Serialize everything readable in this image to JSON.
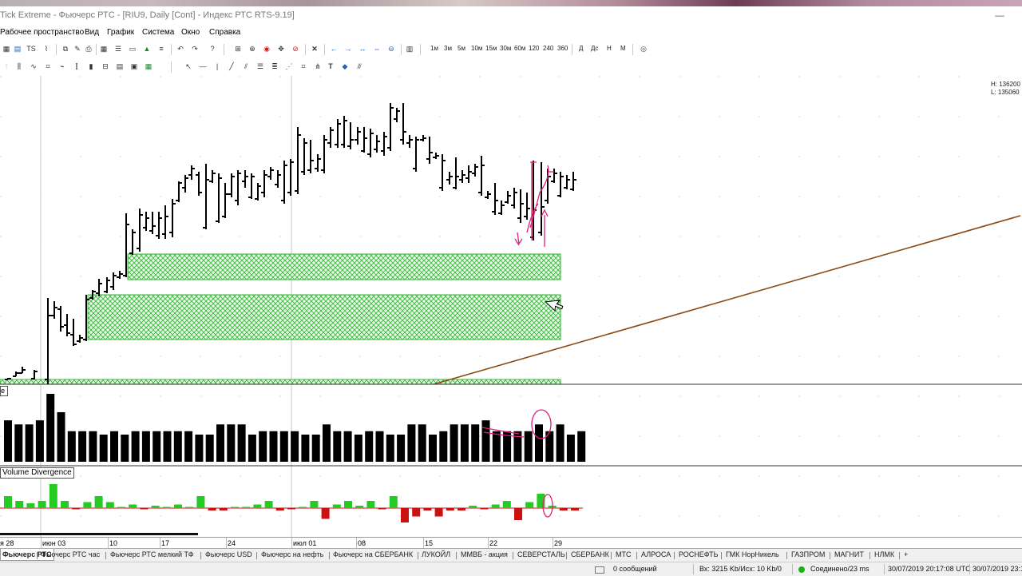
{
  "window": {
    "title": "Tick Extreme - Фьючерс РТС - [RIU9, Daily [Cont] - Индекс РТС RTS-9.19]"
  },
  "menu": [
    "Рабочее пространство",
    "Вид",
    "График",
    "Система",
    "Окно",
    "Справка"
  ],
  "toolbar": {
    "timeframes": [
      "1м",
      "3м",
      "5м",
      "10м",
      "15м",
      "30м",
      "60м",
      "120",
      "240",
      "360"
    ],
    "periods": [
      "Д",
      "Дс",
      "Н",
      "М"
    ]
  },
  "chart": {
    "hl": {
      "high": "H: 136200",
      "low": "L: 135060"
    },
    "indicator_label": "Volume Divergence",
    "price_label_stub": "e",
    "zones_color": "#2db82d",
    "trendline_color": "#8b4a12",
    "annotation_color": "#e0207a",
    "divergence_up_color": "#22cc22",
    "divergence_down_color": "#cc1111"
  },
  "date_axis": {
    "labels": [
      "я 28",
      "июн 03",
      "10",
      "17",
      "24",
      "июл 01",
      "08",
      "15",
      "22",
      "29"
    ]
  },
  "chart_data": {
    "type": "bar",
    "categories": [
      "я 28",
      "июн 03",
      "10",
      "17",
      "24",
      "июл 01",
      "08",
      "15",
      "22",
      "29"
    ],
    "volume_relative": [
      0.61,
      0.55,
      0.55,
      0.61,
      1.0,
      0.73,
      0.45,
      0.45,
      0.45,
      0.4,
      0.45,
      0.4,
      0.45,
      0.45,
      0.45,
      0.45,
      0.45,
      0.45,
      0.4,
      0.4,
      0.55,
      0.55,
      0.55,
      0.4,
      0.45,
      0.45,
      0.45,
      0.45,
      0.4,
      0.4,
      0.55,
      0.45,
      0.45,
      0.4,
      0.45,
      0.45,
      0.4,
      0.4,
      0.55,
      0.55,
      0.4,
      0.45,
      0.55,
      0.55,
      0.55,
      0.61,
      0.45,
      0.45,
      0.45,
      0.45,
      0.55,
      0.45,
      0.55,
      0.4,
      0.45
    ],
    "volume_divergence_relative": [
      0.5,
      0.3,
      0.2,
      0.3,
      1.0,
      0.3,
      -0.05,
      0.25,
      0.5,
      0.25,
      0.05,
      0.15,
      -0.05,
      0.1,
      0.05,
      0.15,
      0.05,
      0.5,
      -0.1,
      -0.1,
      0.05,
      0.05,
      0.15,
      0.3,
      -0.1,
      -0.05,
      0.05,
      0.3,
      -0.45,
      0.15,
      0.3,
      0.1,
      0.3,
      -0.05,
      0.5,
      -0.6,
      -0.35,
      -0.1,
      -0.35,
      -0.1,
      -0.1,
      0.1,
      -0.05,
      0.15,
      0.3,
      -0.5,
      0.25,
      0.6,
      0.1,
      -0.1,
      -0.1
    ]
  },
  "sheet_tabs": [
    "Фьючерс РТС",
    "Фьючерс РТС час",
    "Фьючерс РТС мелкий ТФ",
    "Фьючерс USD",
    "Фьючерс на нефть",
    "Фьючерс на СБЕРБАНК",
    "ЛУКОЙЛ",
    "ММВБ - акция",
    "СЕВЕРСТАЛЬ",
    "СБЕРБАНК",
    "МТС",
    "АЛРОСА",
    "РОСНЕФТЬ",
    "ГМК НорНикель",
    "ГАЗПРОМ",
    "МАГНИТ",
    "НЛМК",
    "+"
  ],
  "status": {
    "messages": "0 сообщений",
    "traffic": "Вх: 3215 Kb/Исх: 10 Kb/0",
    "connection": "Соединено/23 ms",
    "time1": "30/07/2019 20:17:08 UTC",
    "time2": "30/07/2019 23:17"
  }
}
